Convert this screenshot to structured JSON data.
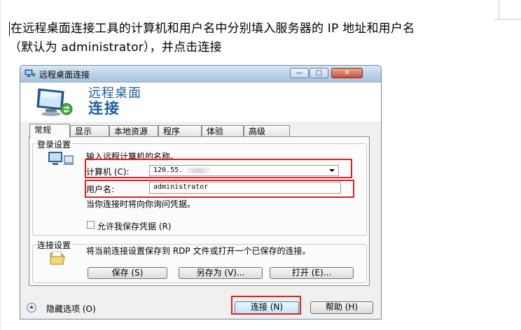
{
  "document": {
    "line1": "在远程桌面连接工具的计算机和用户名中分别填入服务器的 IP 地址和用户名",
    "line2": "（默认为 administrator），并点击连接"
  },
  "window": {
    "title": "远程桌面连接",
    "minimize_glyph": "—",
    "maximize_glyph": "□",
    "close_glyph": "✕",
    "header_line1": "远程桌面",
    "header_line2": "连接"
  },
  "tabs": [
    {
      "label": "常规",
      "active": true
    },
    {
      "label": "显示",
      "active": false
    },
    {
      "label": "本地资源",
      "active": false
    },
    {
      "label": "程序",
      "active": false
    },
    {
      "label": "体验",
      "active": false
    },
    {
      "label": "高级",
      "active": false
    }
  ],
  "login": {
    "group_label": "登录设置",
    "prompt": "输入远程计算机的名称。",
    "computer_label": "计算机 (C):",
    "computer_value": "120.55.",
    "user_label": "用户名:",
    "user_value": "administrator",
    "credential_note": "当你连接时将向你询问凭据。",
    "save_credentials_label": "允许我保存凭据 (R)",
    "save_credentials_checked": false
  },
  "connection": {
    "group_label": "连接设置",
    "description": "将当前连接设置保存到 RDP 文件或打开一个已保存的连接。",
    "save_button": "保存 (S)",
    "save_as_button": "另存为 (V)...",
    "open_button": "打开 (E)..."
  },
  "footer": {
    "hide_options": "隐藏选项 (O)",
    "connect_button": "连接 (N)",
    "help_button": "帮助 (H)"
  },
  "colors": {
    "highlight_box": "#e02020",
    "header_text": "#1d5d9c"
  },
  "icons": {
    "title": "remote-desktop-icon",
    "header": "monitor-connection-icon",
    "login": "computer-icon",
    "connection": "folder-icon",
    "hide_options": "chevron-up-icon"
  }
}
